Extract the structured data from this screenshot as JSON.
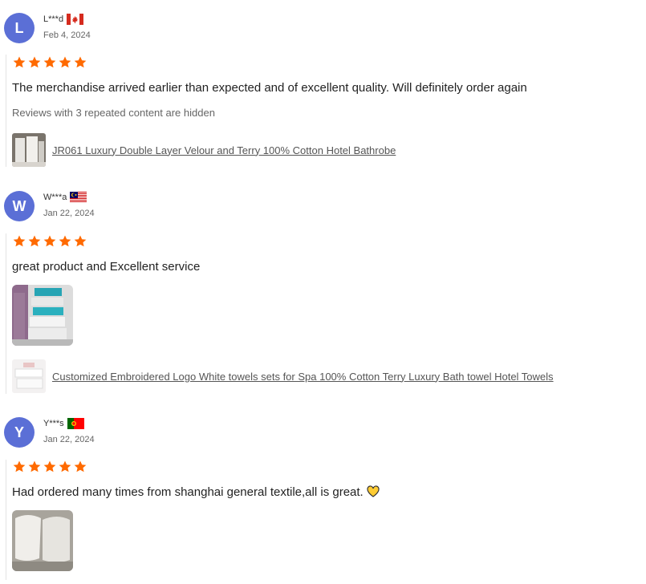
{
  "reviews": [
    {
      "initial": "L",
      "username": "L***d",
      "flag": "canada-flag-icon",
      "date": "Feb 4, 2024",
      "rating": 5,
      "text": "The merchandise arrived earlier than expected and of excellent quality. Will definitely order again",
      "hidden_note": "Reviews with 3 repeated content are hidden",
      "product_name": "JR061 Luxury Double Layer Velour and Terry 100% Cotton Hotel Bathrobe"
    },
    {
      "initial": "W",
      "username": "W***a",
      "flag": "malaysia-flag-icon",
      "date": "Jan 22, 2024",
      "rating": 5,
      "text": "great product and Excellent service",
      "product_name": "Customized Embroidered Logo White towels sets for Spa 100% Cotton Terry Luxury Bath towel Hotel Towels"
    },
    {
      "initial": "Y",
      "username": "Y***s",
      "flag": "portugal-flag-icon",
      "date": "Jan 22, 2024",
      "rating": 5,
      "text": "Had ordered many times from shanghai general textile,all is great. ",
      "emoji": "heart-icon"
    }
  ],
  "colors": {
    "avatar": "#5b6fd6",
    "star": "#ff6a00"
  }
}
